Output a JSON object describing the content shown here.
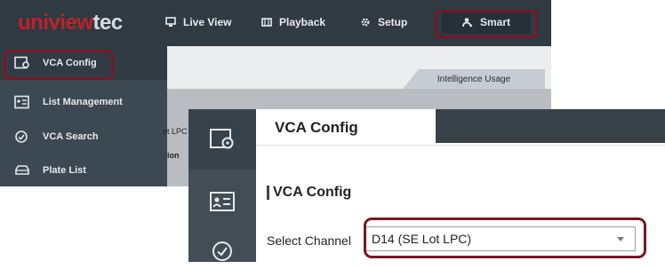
{
  "logo": {
    "part1": "uni",
    "part2": "view",
    "part3": "tec"
  },
  "topnav": {
    "items": [
      {
        "label": "Live View",
        "icon": "monitor-icon"
      },
      {
        "label": "Playback",
        "icon": "film-icon"
      },
      {
        "label": "Setup",
        "icon": "gear-icon"
      },
      {
        "label": "Smart",
        "icon": "person-settings-icon"
      }
    ]
  },
  "sidebar": {
    "items": [
      {
        "label": "VCA Config",
        "icon": "vca-config-icon"
      },
      {
        "label": "List Management",
        "icon": "list-card-icon"
      },
      {
        "label": "VCA Search",
        "icon": "vca-search-icon"
      },
      {
        "label": "Plate List",
        "icon": "car-icon"
      }
    ]
  },
  "back_main": {
    "tab": "Intelligence Usage",
    "partial_1": "ot LPC",
    "partial_2": "ion"
  },
  "front": {
    "header_title": "VCA Config",
    "section_title": "VCA Config",
    "channel_label": "Select Channel",
    "channel_value": "D14 (SE Lot LPC)"
  },
  "colors": {
    "highlight_outline": "#7a1724",
    "topbar": "#2f3a43",
    "sidebar": "#3c4852",
    "logo_red": "#c0212b"
  }
}
